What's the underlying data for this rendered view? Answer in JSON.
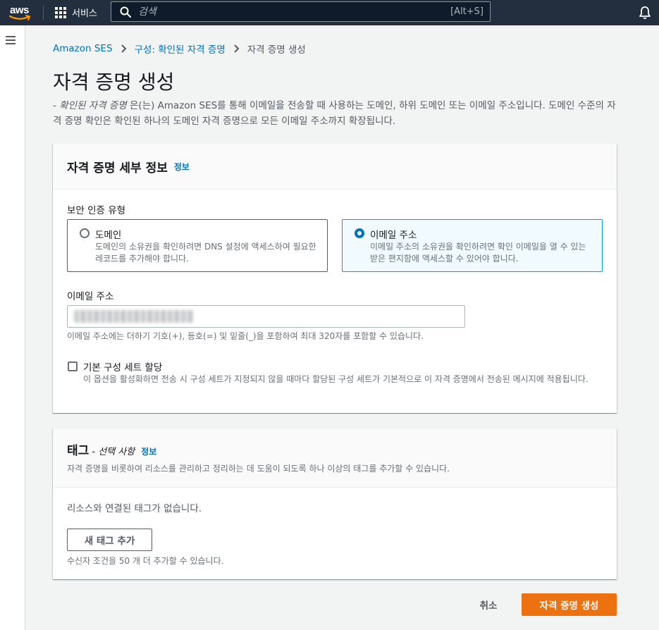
{
  "nav": {
    "logo_text": "aws",
    "services_label": "서비스",
    "search_placeholder": "검색",
    "search_shortcut": "[Alt+S]"
  },
  "breadcrumb": {
    "items": [
      "Amazon SES",
      "구성: 확인된 자격 증명"
    ],
    "current": "자격 증명 생성"
  },
  "page": {
    "title": "자격 증명 생성",
    "desc_prefix": "- ",
    "desc_term": "확인된 자격 증명",
    "desc_rest": " 은(는) Amazon SES를 통해 이메일을 전송할 때 사용하는 도메인, 하위 도메인 또는 이메일 주소입니다. 도메인 수준의 자격 증명 확인은 확인된 하나의 도메인 자격 증명으로 모든 이메일 주소까지 확장됩니다."
  },
  "details": {
    "heading": "자격 증명 세부 정보",
    "info": "정보",
    "type_label": "보안 인증 유형",
    "options": [
      {
        "title": "도메인",
        "desc": "도메인의 소유권을 확인하려면 DNS 설정에 액세스하여 필요한 레코드를 추가해야 합니다.",
        "selected": false
      },
      {
        "title": "이메일 주소",
        "desc": "이메일 주소의 소유권을 확인하려면 확인 이메일을 열 수 있는 받은 편지함에 액세스할 수 있어야 합니다.",
        "selected": true
      }
    ],
    "email_label": "이메일 주소",
    "email_value": "",
    "email_hint": "이메일 주소에는 더하기 기호(+), 등호(=) 및 밑줄(_)을 포함하여 최대 320자를 포함할 수 있습니다.",
    "config_set_title": "기본 구성 세트 할당",
    "config_set_desc": "이 옵션을 활성화하면 전송 시 구성 세트가 지정되지 않을 때마다 할당된 구성 세트가 기본적으로 이 자격 증명에서 전송된 메시지에 적용됩니다.",
    "config_set_checked": false
  },
  "tags": {
    "heading": "태그",
    "optional": " - 선택 사항",
    "info": "정보",
    "desc": "자격 증명을 비롯하여 리소스를 관리하고 정리하는 데 도움이 되도록 하나 이상의 태그를 추가할 수 있습니다.",
    "empty": "리소스와 연결된 태그가 없습니다.",
    "add_button": "새 태그 추가",
    "limit": "수신자 조건을 50 개 더 추가할 수 있습니다."
  },
  "actions": {
    "cancel": "취소",
    "submit": "자격 증명 생성"
  },
  "colors": {
    "nav_bg": "#232f3e",
    "link": "#0073bb",
    "primary": "#ec7211",
    "selected_border": "#00a1c9"
  }
}
